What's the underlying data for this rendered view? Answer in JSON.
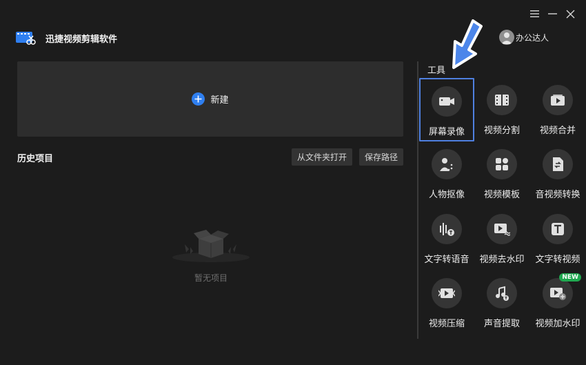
{
  "app": {
    "name": "迅捷视频剪辑软件"
  },
  "user": {
    "name": "办公达人"
  },
  "window_controls": {
    "menu_icon": "menu-icon",
    "minimize_icon": "minimize-icon",
    "close_icon": "close-icon"
  },
  "new_project": {
    "label": "新建"
  },
  "history": {
    "title": "历史项目",
    "open_folder_label": "从文件夹打开",
    "save_path_label": "保存路径",
    "empty_label": "暂无项目"
  },
  "tools": {
    "title": "工具",
    "items": [
      {
        "label": "屏幕录像",
        "icon": "camera-icon",
        "selected": true
      },
      {
        "label": "视频分割",
        "icon": "film-split-icon"
      },
      {
        "label": "视频合并",
        "icon": "video-merge-icon"
      },
      {
        "label": "人物抠像",
        "icon": "person-cutout-icon"
      },
      {
        "label": "视频模板",
        "icon": "template-icon"
      },
      {
        "label": "音视频转换",
        "icon": "convert-icon"
      },
      {
        "label": "文字转语音",
        "icon": "text-to-speech-icon"
      },
      {
        "label": "视频去水印",
        "icon": "remove-watermark-icon"
      },
      {
        "label": "文字转视频",
        "icon": "text-to-video-icon"
      },
      {
        "label": "视频压缩",
        "icon": "compress-icon"
      },
      {
        "label": "声音提取",
        "icon": "audio-extract-icon"
      },
      {
        "label": "视频加水印",
        "icon": "add-watermark-icon",
        "badge": "NEW"
      }
    ]
  },
  "colors": {
    "background": "#1c1c1c",
    "card": "#2d2d2d",
    "accent": "#2f7ff0",
    "selected_border": "#4f80e0",
    "badge": "#1fa84f"
  }
}
